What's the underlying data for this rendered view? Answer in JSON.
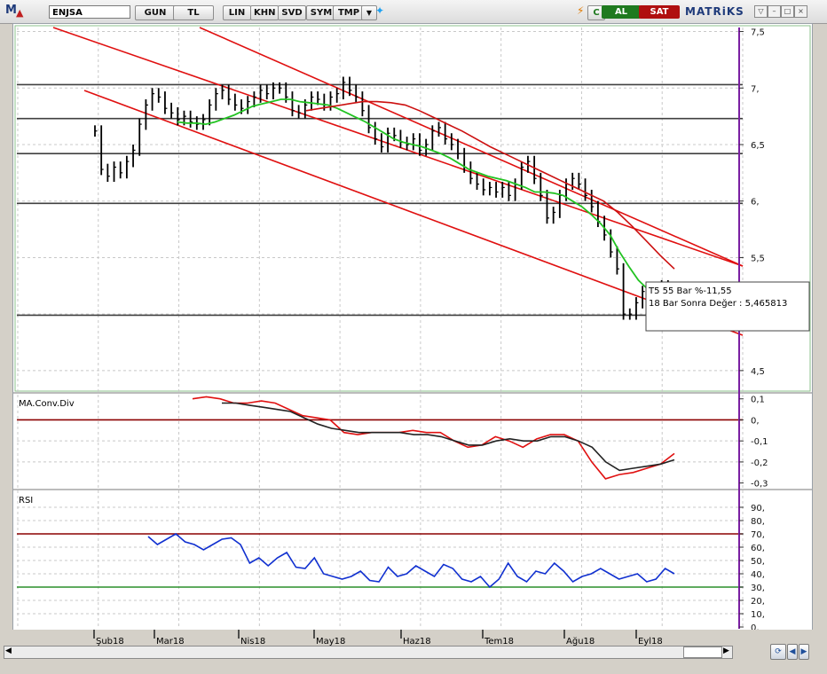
{
  "toolbar": {
    "logo": "M",
    "symbol": "ENJSA",
    "buttons": [
      "GUN",
      "TL",
      "LIN",
      "KHN",
      "SVD",
      "SYM",
      "TMP"
    ],
    "al": "AL",
    "sat": "SAT",
    "c": "C",
    "brand": "MATRiKS"
  },
  "panels": {
    "macd_title": "MA.Conv.Div",
    "rsi_title": "RSI"
  },
  "tooltip": {
    "line1": "T5 55 Bar %-11,55",
    "line2": "18 Bar Sonra Değer : 5,465813"
  },
  "colors": {
    "price": "#000000",
    "sma_green": "#22c322",
    "sma_red": "#cc1010",
    "channel": "#e01010",
    "macd_red": "#e01010",
    "macd_black": "#222222",
    "rsi": "#1030d0",
    "rsi_upper": "#8b0000",
    "rsi_lower": "#2a8f2a",
    "vertical_marker": "#7a1fa2",
    "horizontal_levels": "#404040"
  },
  "chart_data": [
    {
      "type": "ohlc",
      "panel": "price",
      "ylim": [
        4.35,
        7.52
      ],
      "yticks": [
        "7,5",
        "7,",
        "6,5",
        "6,",
        "5,5",
        "4,5"
      ],
      "horizontal_levels": [
        7.03,
        6.73,
        6.42,
        5.98,
        4.99
      ],
      "x_months": [
        "Şub18",
        "Mar18",
        "Nis18",
        "May18",
        "Haz18",
        "Tem18",
        "Ağu18",
        "Eyl18"
      ],
      "close": [
        6.62,
        6.28,
        6.22,
        6.3,
        6.25,
        6.35,
        6.45,
        6.68,
        6.85,
        6.95,
        6.92,
        6.82,
        6.78,
        6.72,
        6.75,
        6.7,
        6.68,
        6.72,
        6.85,
        6.95,
        6.98,
        6.9,
        6.85,
        6.82,
        6.88,
        6.92,
        6.98,
        6.95,
        7.0,
        7.0,
        6.92,
        6.8,
        6.78,
        6.85,
        6.92,
        6.9,
        6.85,
        6.92,
        6.95,
        7.05,
        6.98,
        6.92,
        6.8,
        6.65,
        6.55,
        6.48,
        6.6,
        6.58,
        6.52,
        6.5,
        6.55,
        6.45,
        6.5,
        6.62,
        6.65,
        6.55,
        6.5,
        6.42,
        6.3,
        6.2,
        6.15,
        6.1,
        6.12,
        6.08,
        6.12,
        6.05,
        6.15,
        6.3,
        6.35,
        6.2,
        6.05,
        5.85,
        5.9,
        6.05,
        6.15,
        6.2,
        6.15,
        6.05,
        5.95,
        5.82,
        5.7,
        5.55,
        5.4,
        5.0,
        5.0,
        5.1,
        5.2,
        5.15,
        5.2,
        5.25,
        5.2,
        5.18
      ],
      "series": [
        {
          "name": "",
          "kind": "sma_green",
          "values": [
            6.7,
            6.69,
            6.69,
            6.68,
            6.7,
            6.73,
            6.76,
            6.8,
            6.84,
            6.86,
            6.88,
            6.9,
            6.9,
            6.88,
            6.87,
            6.86,
            6.85,
            6.82,
            6.78,
            6.74,
            6.7,
            6.65,
            6.6,
            6.55,
            6.52,
            6.5,
            6.48,
            6.45,
            6.42,
            6.38,
            6.33,
            6.28,
            6.25,
            6.22,
            6.2,
            6.18,
            6.15,
            6.12,
            6.08,
            6.08,
            6.07,
            6.05,
            6.0,
            5.95,
            5.88,
            5.8,
            5.7,
            5.55,
            5.42,
            5.3,
            5.22
          ]
        },
        {
          "name": "",
          "kind": "sma_red",
          "values": [
            6.8,
            6.82,
            6.84,
            6.86,
            6.88,
            6.88,
            6.87,
            6.85,
            6.8,
            6.74,
            6.68,
            6.62,
            6.55,
            6.48,
            6.42,
            6.36,
            6.3,
            6.24,
            6.18,
            6.12,
            6.06,
            6.0,
            5.9,
            5.78,
            5.65,
            5.52,
            5.4
          ]
        }
      ]
    },
    {
      "type": "line",
      "panel": "macd",
      "yticks": [
        "0,1",
        "0,",
        "-0,1",
        "-0,2",
        "-0,3"
      ],
      "ylim": [
        -0.31,
        0.12
      ],
      "zero_line": 0.0,
      "series": [
        {
          "name": "",
          "color_key": "macd_red",
          "values": [
            0.1,
            0.11,
            0.1,
            0.08,
            0.08,
            0.09,
            0.08,
            0.05,
            0.02,
            0.01,
            0.0,
            -0.06,
            -0.07,
            -0.06,
            -0.06,
            -0.06,
            -0.05,
            -0.06,
            -0.06,
            -0.1,
            -0.13,
            -0.12,
            -0.08,
            -0.1,
            -0.13,
            -0.09,
            -0.07,
            -0.07,
            -0.1,
            -0.2,
            -0.28,
            -0.26,
            -0.25,
            -0.23,
            -0.21,
            -0.16
          ]
        },
        {
          "name": "",
          "color_key": "macd_black",
          "values": [
            0.08,
            0.08,
            0.07,
            0.06,
            0.05,
            0.04,
            0.01,
            -0.02,
            -0.04,
            -0.05,
            -0.06,
            -0.06,
            -0.06,
            -0.06,
            -0.07,
            -0.07,
            -0.08,
            -0.1,
            -0.12,
            -0.12,
            -0.1,
            -0.09,
            -0.1,
            -0.1,
            -0.08,
            -0.08,
            -0.1,
            -0.13,
            -0.2,
            -0.24,
            -0.23,
            -0.22,
            -0.21,
            -0.19
          ]
        }
      ]
    },
    {
      "type": "line",
      "panel": "rsi",
      "yticks": [
        "90,",
        "80,",
        "70,",
        "60,",
        "50,",
        "40,",
        "30,",
        "20,",
        "10,",
        "0,"
      ],
      "ylim": [
        0,
        100
      ],
      "levels": [
        70,
        30
      ],
      "series": [
        {
          "name": "",
          "color_key": "rsi",
          "values": [
            68,
            62,
            66,
            70,
            64,
            62,
            58,
            62,
            66,
            67,
            62,
            48,
            52,
            46,
            52,
            56,
            45,
            44,
            52,
            40,
            38,
            36,
            38,
            42,
            35,
            34,
            45,
            38,
            40,
            46,
            42,
            38,
            47,
            44,
            36,
            34,
            38,
            30,
            36,
            48,
            38,
            34,
            42,
            40,
            48,
            42,
            34,
            38,
            40,
            44,
            40,
            36,
            38,
            40,
            34,
            36,
            44,
            40
          ]
        }
      ]
    }
  ]
}
